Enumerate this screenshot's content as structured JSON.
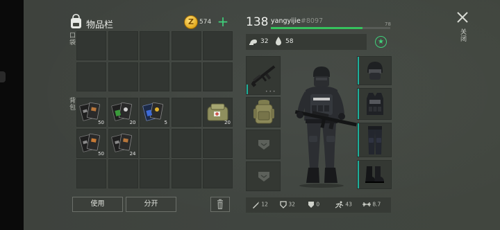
{
  "inventory": {
    "title": "物品栏",
    "coins": "574",
    "coin_symbol": "Z",
    "add_symbol": "+",
    "section_pockets": "口袋",
    "section_backpack": "背包",
    "backpack_counts": [
      "50",
      "20",
      "5",
      "20",
      "50",
      "24"
    ],
    "use_button": "使用",
    "split_button": "分开",
    "icons": [
      "backpack-icon",
      "coin-icon",
      "add-icon",
      "trash-icon",
      "notebook-icon",
      "first-aid-kit-icon"
    ]
  },
  "character": {
    "level": "138",
    "username": "yangyijie",
    "user_tag": "#8097",
    "xp_value": "78",
    "xp_progress": 0.77,
    "food": "32",
    "water": "58",
    "close_label": "关闭",
    "favorite_symbol": "★",
    "stats": {
      "attack": "12",
      "armor": "32",
      "shield": "0",
      "speed": "43",
      "weight": "8.7"
    },
    "colors": {
      "accent_green": "#36c25d",
      "slot_edge": "#1db09b"
    },
    "icons": [
      "rifle-icon",
      "military-backpack-icon",
      "helmet-icon",
      "vest-icon",
      "pants-icon",
      "boots-icon",
      "close-icon",
      "star-icon"
    ]
  }
}
